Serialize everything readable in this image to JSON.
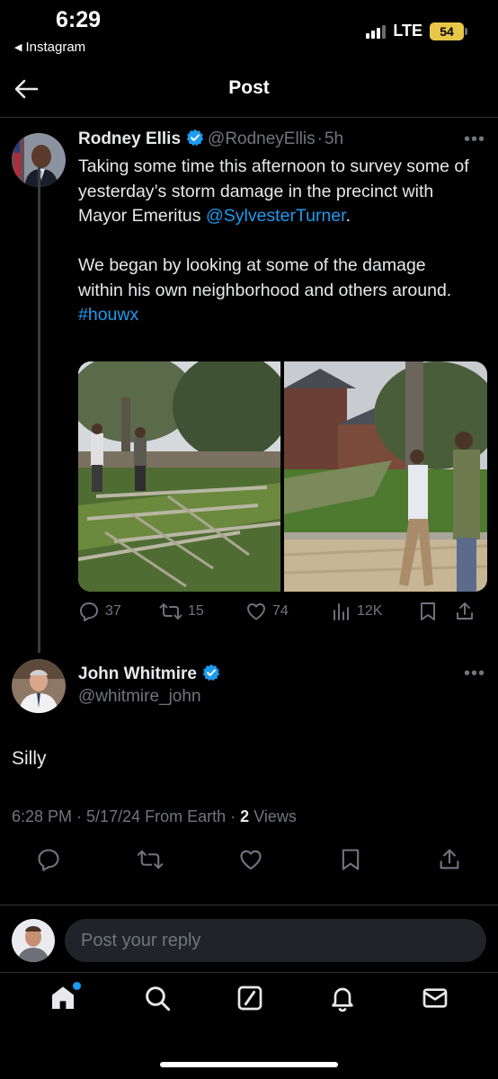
{
  "status_bar": {
    "time": "6:29",
    "back_app": "Instagram",
    "network": "LTE",
    "battery": "54"
  },
  "header": {
    "title": "Post"
  },
  "original_post": {
    "author_name": "Rodney Ellis",
    "handle": "@RodneyEllis",
    "separator": "·",
    "time": "5h",
    "text_p1_before": "Taking some time this afternoon to survey some of yesterday’s storm damage in the precinct with Mayor Emeritus ",
    "text_p1_mention": "@SylvesterTurner",
    "text_p1_after": ".",
    "text_p2_before": "We began by looking at some of the damage within his own neighborhood and others around. ",
    "text_p2_hashtag": "#houwx",
    "replies": "37",
    "reposts": "15",
    "likes": "74",
    "views": "12K"
  },
  "reply_post": {
    "author_name": "John Whitmire",
    "handle": "@whitmire_john",
    "text": "Silly",
    "time": "6:28 PM",
    "date": "5/17/24",
    "source": "From Earth",
    "views_count": "2",
    "views_label": "Views"
  },
  "compose": {
    "placeholder": "Post your reply"
  },
  "colors": {
    "accent": "#1d9bf0",
    "background": "#000000",
    "muted": "#71767b"
  },
  "icons": {
    "tabbar": [
      "home-icon",
      "search-icon",
      "grok-icon",
      "notifications-icon",
      "messages-icon"
    ]
  }
}
